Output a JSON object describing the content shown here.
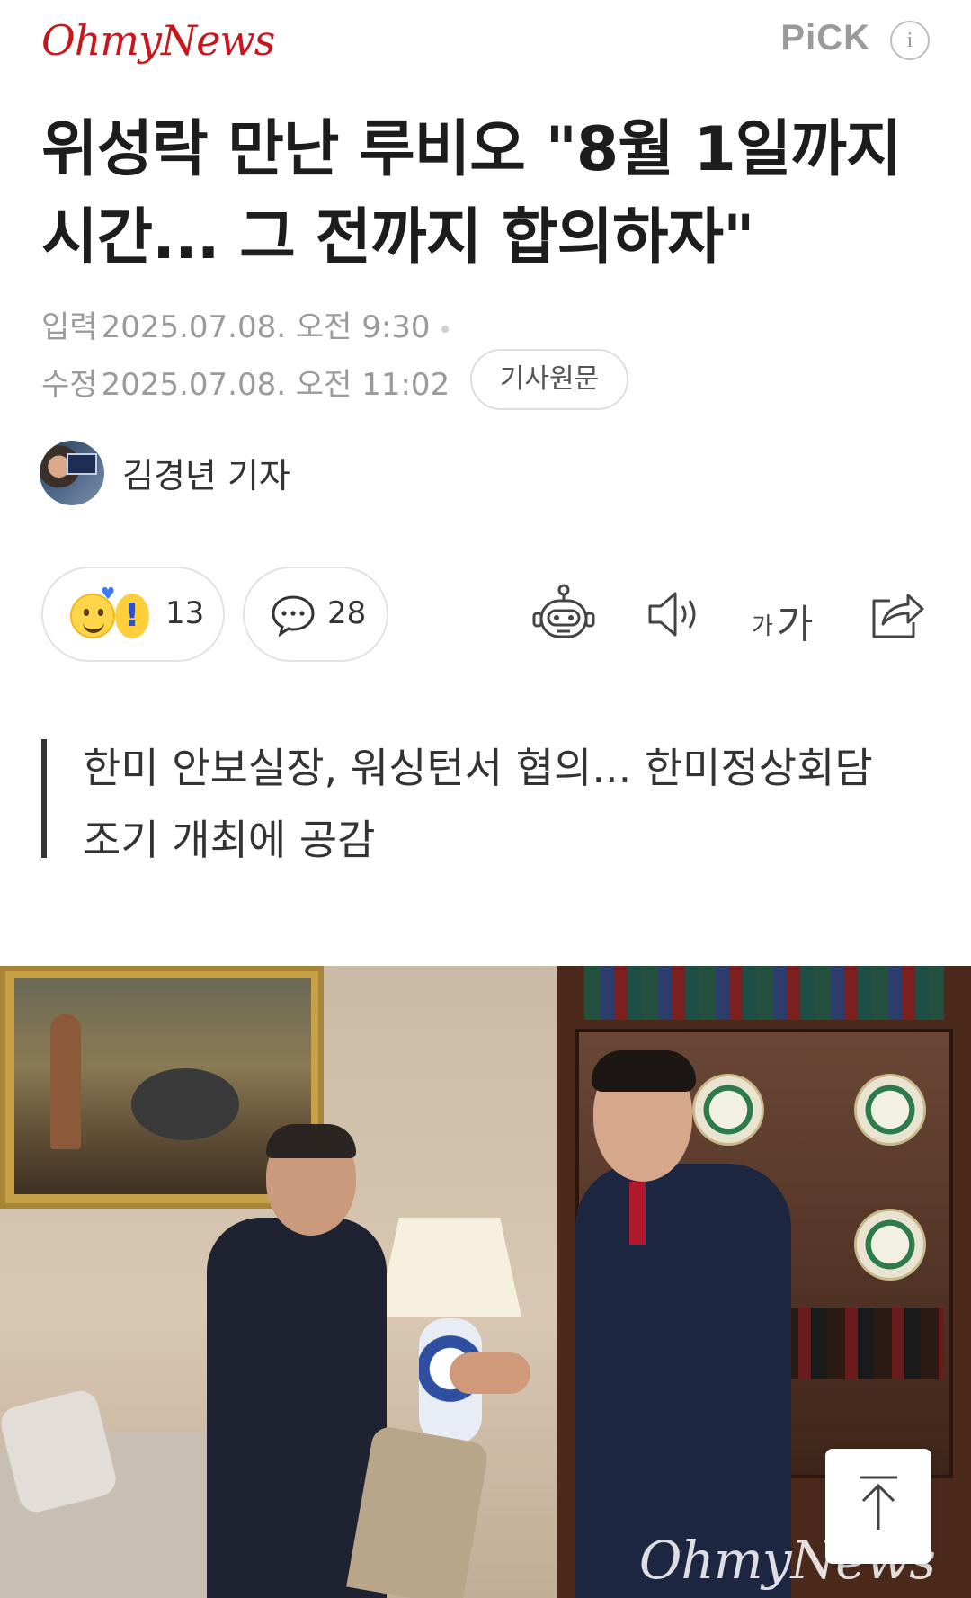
{
  "header": {
    "logo": "OhmyNews",
    "pick_label": "PiCK",
    "info_label": "i"
  },
  "article": {
    "headline": "위성락 만난 루비오 \"8월 1일까지 시간... 그 전까지 합의하자\"",
    "published_label": "입력",
    "published_value": "2025.07.08. 오전 9:30",
    "modified_label": "수정",
    "modified_value": "2025.07.08. 오전 11:02",
    "original_button": "기사원문",
    "author": "김경년 기자",
    "subtitle": "한미 안보실장, 워싱턴서 협의... 한미정상회담 조기 개최에 공감"
  },
  "actions": {
    "reaction_count": "13",
    "comment_count": "28",
    "font_small": "가",
    "font_large": "가",
    "icons": [
      "smile-emoji-icon",
      "exclamation-emoji-icon",
      "comment-bubble-icon",
      "ai-robot-icon",
      "speaker-icon",
      "font-size-icon",
      "share-icon",
      "arrow-up-icon"
    ]
  },
  "photo": {
    "watermark": "OhmyNews"
  },
  "colors": {
    "brand_red": "#c8161d",
    "text_dark": "#1d1d1d",
    "meta_gray": "#9b9b9b"
  }
}
